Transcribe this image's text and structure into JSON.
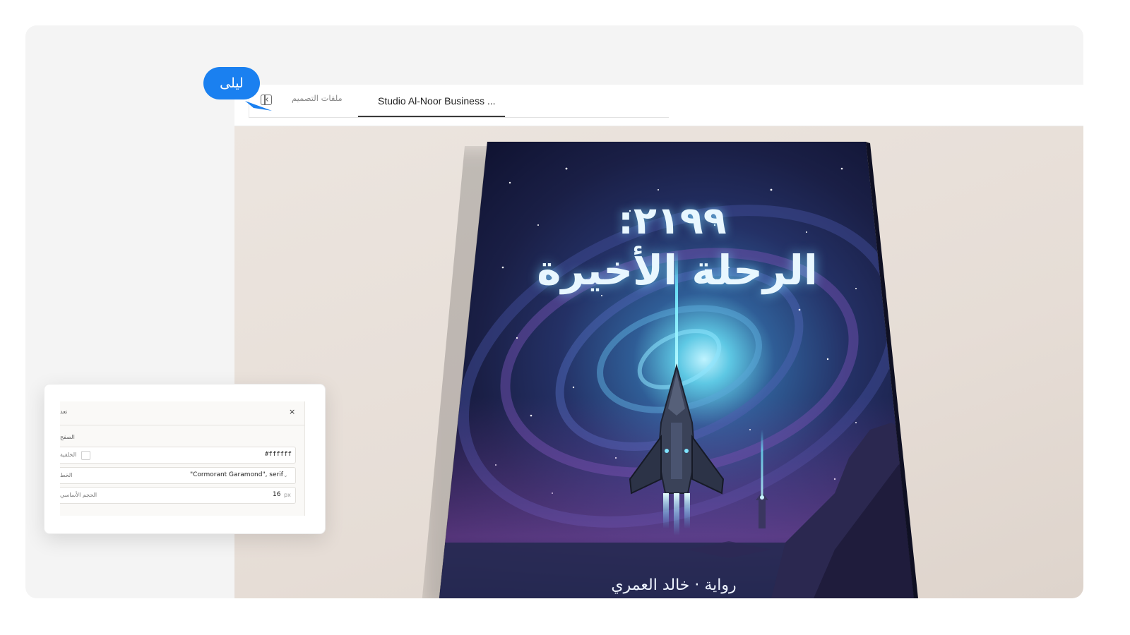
{
  "user": {
    "name": "ليلى"
  },
  "tabs": {
    "design_files": "ملفات التصميم",
    "active": "Studio Al-Noor Business ..."
  },
  "cover": {
    "title_number": "٢١٩٩:",
    "title_main": "الرحلة الأخيرة",
    "author_line": "رواية · خالد العمري"
  },
  "properties": {
    "panel_title": "تعد",
    "close": "×",
    "section": "الصفح",
    "background": {
      "label": "الخلفية",
      "value": "#ffffff"
    },
    "font": {
      "label": "الخط",
      "value": "\"Cormorant Garamond\", serif"
    },
    "base_size": {
      "label": "الحجم الأساسي",
      "value": "16",
      "unit": "px"
    }
  },
  "colors": {
    "bubble": "#1a80f0",
    "canvas": "#e9e2db",
    "title_glow": "#78dcff"
  }
}
